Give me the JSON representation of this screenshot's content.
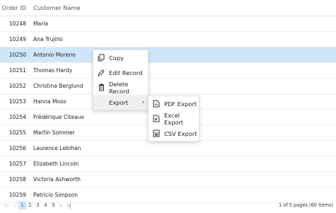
{
  "grid": {
    "headers": {
      "id": "Order ID",
      "name": "Customer Name"
    },
    "rows": [
      {
        "id": "10248",
        "name": "Maria"
      },
      {
        "id": "10249",
        "name": "Ana Trujillo"
      },
      {
        "id": "10250",
        "name": "Antonio Moreno"
      },
      {
        "id": "10251",
        "name": "Thomas Hardy"
      },
      {
        "id": "10252",
        "name": "Christina Berglund"
      },
      {
        "id": "10253",
        "name": "Hanna Moos"
      },
      {
        "id": "10254",
        "name": "Frédérique Citeaux"
      },
      {
        "id": "10255",
        "name": "Martín Sommer"
      },
      {
        "id": "10256",
        "name": "Laurence Lebihan"
      },
      {
        "id": "10257",
        "name": "Elizabeth Lincoln"
      },
      {
        "id": "10258",
        "name": "Victoria Ashworth"
      },
      {
        "id": "10259",
        "name": "Patricio Simpson"
      }
    ],
    "selected_row_index": 2,
    "selected_color": "#cfe6fb"
  },
  "pager": {
    "first": "|<",
    "prev": "<",
    "pages": [
      "1",
      "2",
      "3",
      "4",
      "5"
    ],
    "next": ">",
    "last": ">|",
    "info": "1 of 5 pages (60 items)",
    "active_page": "1"
  },
  "context_menu": {
    "items": {
      "copy": {
        "label": "Copy",
        "icon": "copy-icon"
      },
      "edit": {
        "label": "Edit Record",
        "icon": "pencil-icon"
      },
      "delete": {
        "label": "Delete Record",
        "icon": "trash-icon"
      },
      "export": {
        "label": "Export",
        "icon": "chevron-right-icon"
      }
    }
  },
  "export_submenu": {
    "items": {
      "pdf": {
        "label": "PDF Export",
        "icon": "pdf-file-icon"
      },
      "excel": {
        "label": "Excel Export",
        "icon": "excel-file-icon"
      },
      "csv": {
        "label": "CSV Export",
        "icon": "csv-file-icon"
      }
    }
  }
}
